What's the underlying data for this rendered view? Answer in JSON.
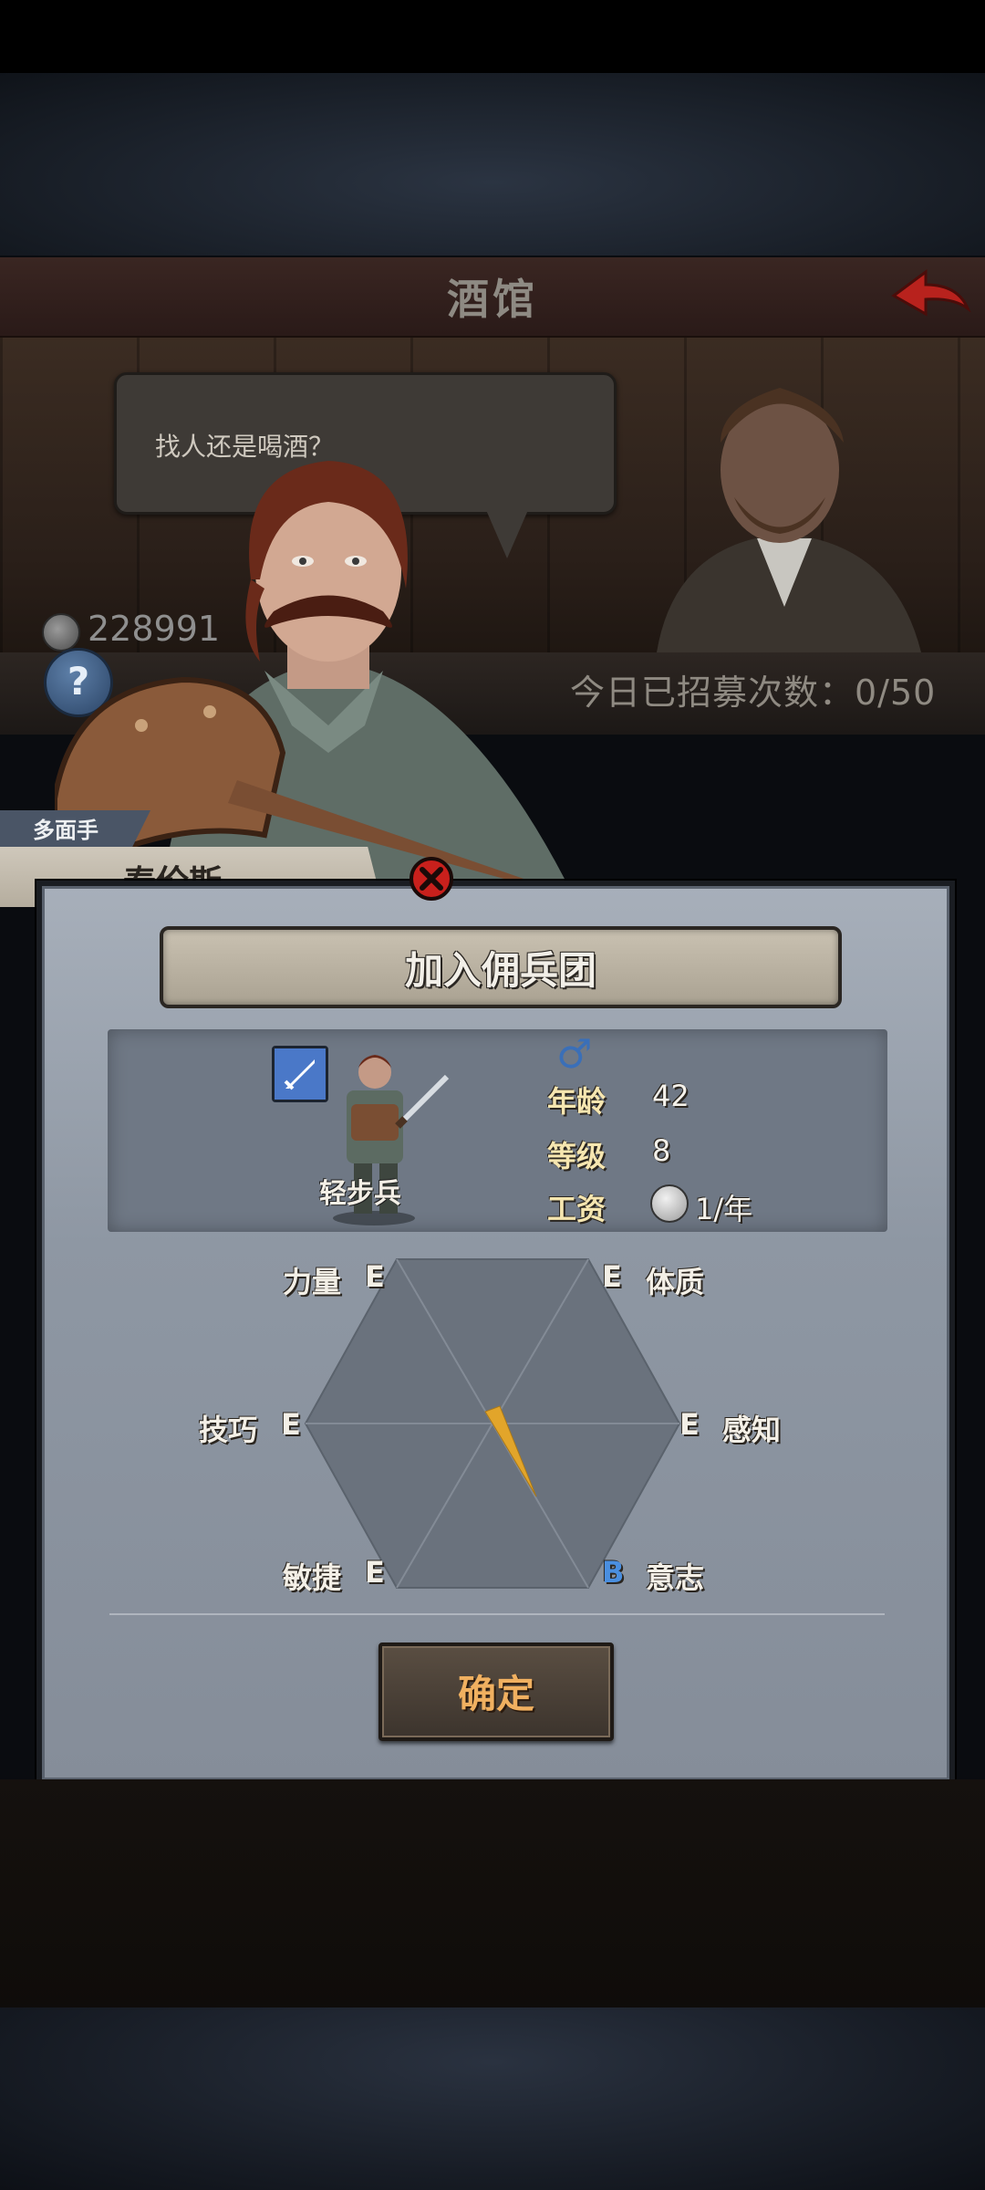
{
  "tavern": {
    "title": "酒馆",
    "speech": "找人还是喝酒？",
    "currency": "228991",
    "recruit_count": "今日已招募次数：0/50"
  },
  "hero": {
    "trait": "多面手",
    "name": "泰伦斯"
  },
  "dialog": {
    "title": "加入佣兵团",
    "class_label": "轻步兵",
    "gender": "♂",
    "stats": {
      "age_label": "年龄",
      "age_value": "42",
      "level_label": "等级",
      "level_value": "8",
      "wage_label": "工资",
      "wage_value": "1/年"
    },
    "attributes": [
      {
        "name": "力量",
        "grade": "E"
      },
      {
        "name": "体质",
        "grade": "E"
      },
      {
        "name": "技巧",
        "grade": "E"
      },
      {
        "name": "感知",
        "grade": "E"
      },
      {
        "name": "敏捷",
        "grade": "E"
      },
      {
        "name": "意志",
        "grade": "B"
      }
    ],
    "confirm": "确定"
  },
  "colors": {
    "grade_b": "#4a8fe0",
    "confirm_text": "#f0b060",
    "stat_label": "#f6e6b0",
    "chart_fill": "#e2a52a"
  }
}
